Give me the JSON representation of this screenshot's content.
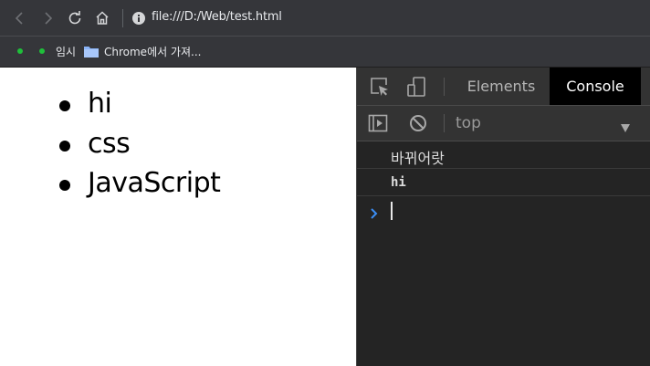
{
  "browser": {
    "url": "file:///D:/Web/test.html",
    "icons": {
      "back": "back-arrow-icon",
      "forward": "forward-arrow-icon",
      "reload": "reload-icon",
      "home": "home-icon",
      "site_info": "info-icon"
    }
  },
  "bookmarks": {
    "items": [
      {
        "label": "",
        "icon": "green-dot-icon"
      },
      {
        "label": "임시",
        "icon": "green-dot-icon"
      },
      {
        "label": "Chrome에서 가져...",
        "icon": "folder-icon"
      }
    ]
  },
  "page": {
    "list_items": [
      "hi",
      "css",
      "JavaScript"
    ]
  },
  "devtools": {
    "tabs": {
      "elements": "Elements",
      "console": "Console"
    },
    "active_tab": "Console",
    "context": "top",
    "console_messages": [
      "바뀌어랏",
      "hi"
    ],
    "colors": {
      "background": "#242424",
      "toolbar": "#333333",
      "active_tab_bg": "#000000",
      "prompt_accent": "#3b8ef5"
    }
  }
}
